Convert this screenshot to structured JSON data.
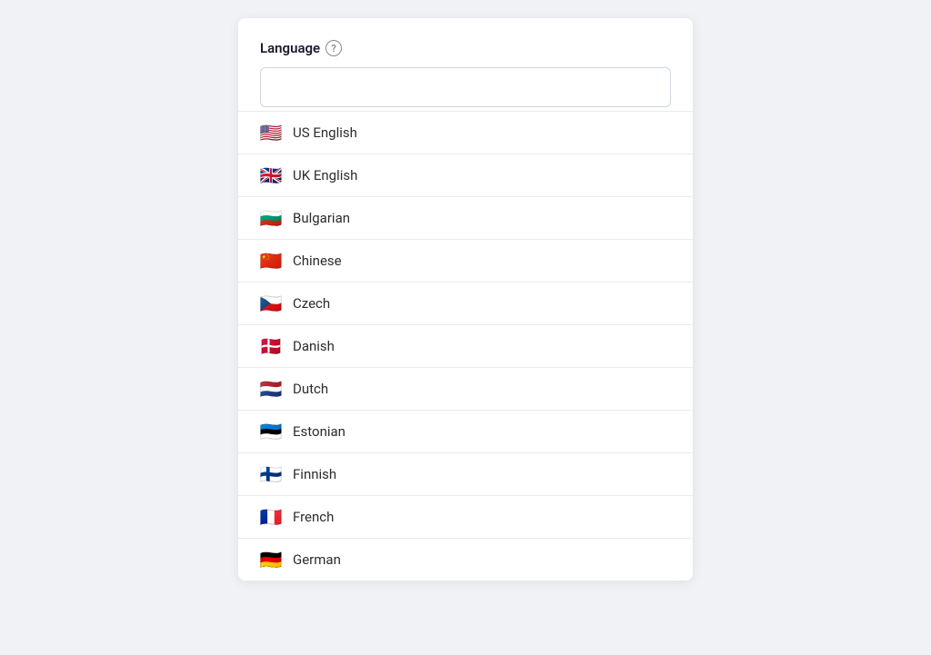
{
  "header": {
    "label": "Language",
    "help_icon": "?"
  },
  "search": {
    "placeholder": "",
    "value": ""
  },
  "languages": [
    {
      "id": "us-english",
      "name": "US English",
      "flag": "🇺🇸"
    },
    {
      "id": "uk-english",
      "name": "UK English",
      "flag": "🇬🇧"
    },
    {
      "id": "bulgarian",
      "name": "Bulgarian",
      "flag": "🇧🇬"
    },
    {
      "id": "chinese",
      "name": "Chinese",
      "flag": "🇨🇳"
    },
    {
      "id": "czech",
      "name": "Czech",
      "flag": "🇨🇿"
    },
    {
      "id": "danish",
      "name": "Danish",
      "flag": "🇩🇰"
    },
    {
      "id": "dutch",
      "name": "Dutch",
      "flag": "🇳🇱"
    },
    {
      "id": "estonian",
      "name": "Estonian",
      "flag": "🇪🇪"
    },
    {
      "id": "finnish",
      "name": "Finnish",
      "flag": "🇫🇮"
    },
    {
      "id": "french",
      "name": "French",
      "flag": "🇫🇷"
    },
    {
      "id": "german",
      "name": "German",
      "flag": "🇩🇪"
    }
  ]
}
